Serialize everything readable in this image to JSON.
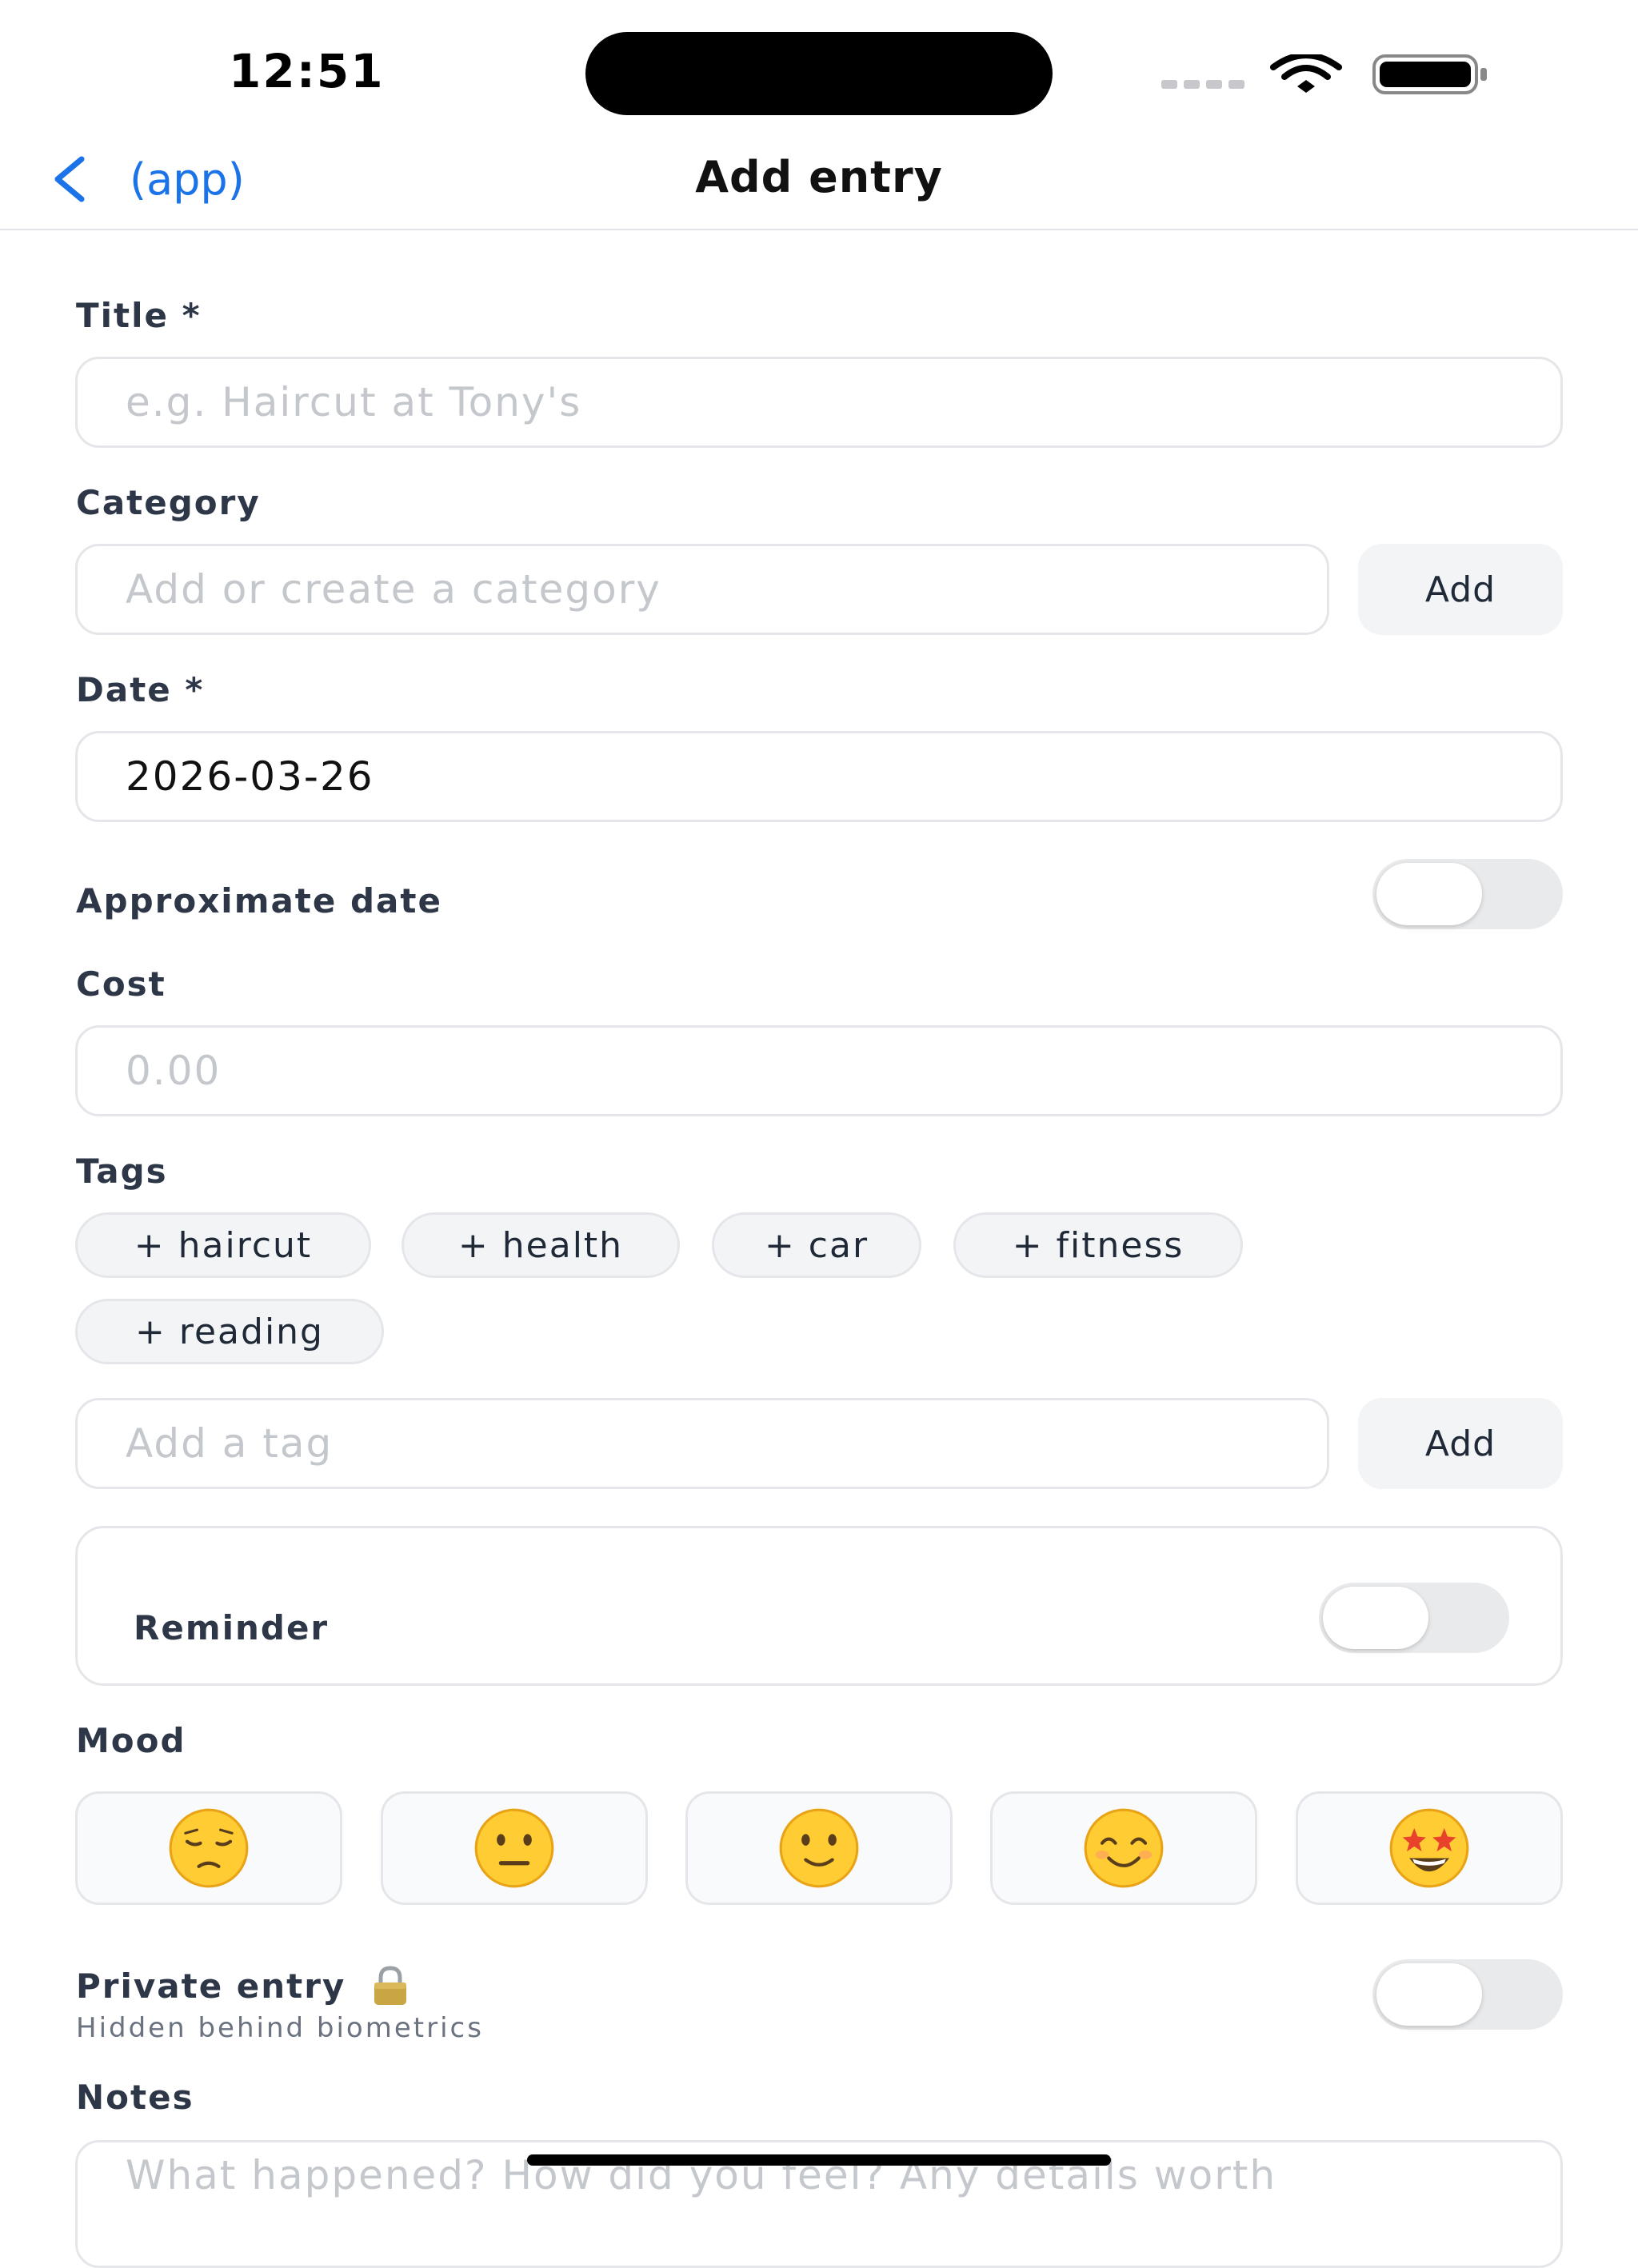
{
  "status_bar": {
    "time": "12:51"
  },
  "nav": {
    "back_label": "(app)",
    "title": "Add entry"
  },
  "form": {
    "title": {
      "label": "Title *",
      "placeholder": "e.g. Haircut at Tony's",
      "value": ""
    },
    "category": {
      "label": "Category",
      "placeholder": "Add or create a category",
      "add_label": "Add"
    },
    "date": {
      "label": "Date *",
      "value": "2026-03-26"
    },
    "approximate_date": {
      "label": "Approximate date",
      "on": false
    },
    "cost": {
      "label": "Cost",
      "placeholder": "0.00"
    },
    "tags": {
      "label": "Tags",
      "suggestions": [
        "+ haircut",
        "+ health",
        "+ car",
        "+ fitness",
        "+ reading"
      ],
      "input_placeholder": "Add a tag",
      "add_label": "Add"
    },
    "reminder": {
      "label": "Reminder",
      "on": false
    },
    "mood": {
      "label": "Mood",
      "options": [
        "pensive-face-icon",
        "neutral-face-icon",
        "slightly-smiling-face-icon",
        "smiling-face-icon",
        "star-struck-face-icon"
      ]
    },
    "private_entry": {
      "label": "Private entry",
      "sublabel": "Hidden behind biometrics",
      "on": false
    },
    "notes": {
      "label": "Notes",
      "placeholder": "What happened? How did you feel? Any details worth"
    }
  },
  "colors": {
    "accent": "#1a73e8",
    "border": "#e4e6ea",
    "chip_background": "#f3f4f6",
    "toggle_off": "#e9eaec",
    "emoji_yellow": "#ffcc33"
  }
}
